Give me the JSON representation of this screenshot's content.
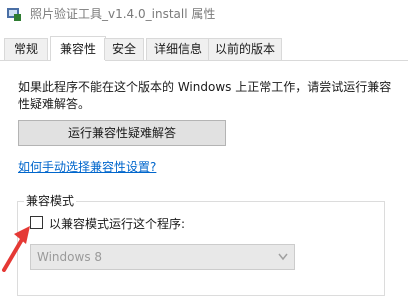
{
  "window": {
    "title": "照片验证工具_v1.4.0_install 属性",
    "icon": "app-icon"
  },
  "tabs": [
    {
      "label": "常规",
      "active": false
    },
    {
      "label": "兼容性",
      "active": true
    },
    {
      "label": "安全",
      "active": false
    },
    {
      "label": "详细信息",
      "active": false
    },
    {
      "label": "以前的版本",
      "active": false
    }
  ],
  "compat": {
    "intro": "如果此程序不能在这个版本的 Windows 上正常工作，请尝试运行兼容性疑难解答。",
    "troubleshoot_button": "运行兼容性疑难解答",
    "manual_link": "如何手动选择兼容性设置?",
    "mode_group_label": "兼容模式",
    "mode_checkbox_label": "以兼容模式运行这个程序:",
    "mode_checkbox_checked": false,
    "mode_select_value": "Windows 8",
    "mode_select_disabled": true
  },
  "colors": {
    "link": "#0066cc",
    "annotation_arrow": "#e53935"
  }
}
